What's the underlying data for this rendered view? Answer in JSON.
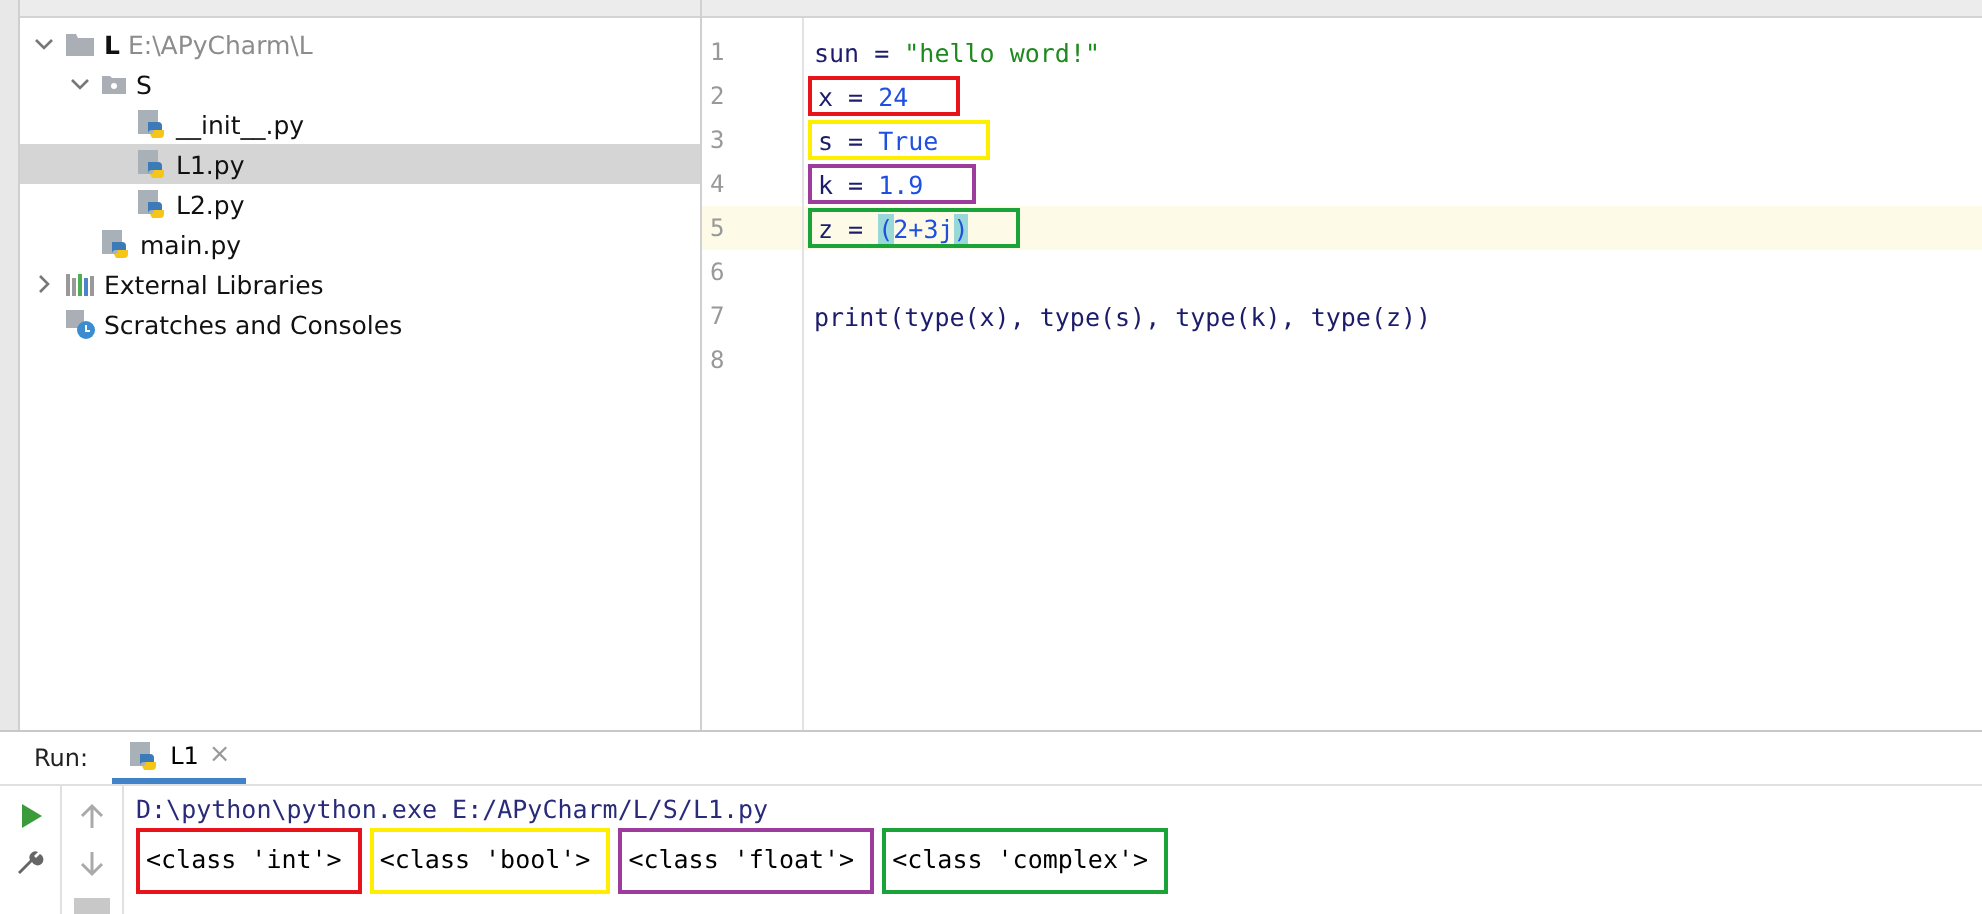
{
  "project_tree": [
    {
      "name": "L",
      "path": "E:\\APyCharm\\L",
      "kind": "root",
      "expanded": true,
      "selected": false,
      "children": [
        {
          "name": "S",
          "kind": "package",
          "expanded": true,
          "selected": false,
          "children": [
            {
              "name": "__init__.py",
              "kind": "python",
              "selected": false
            },
            {
              "name": "L1.py",
              "kind": "python",
              "selected": true
            },
            {
              "name": "L2.py",
              "kind": "python",
              "selected": false
            }
          ]
        },
        {
          "name": "main.py",
          "kind": "python",
          "selected": false
        }
      ]
    },
    {
      "name": "External Libraries",
      "kind": "libraries",
      "expanded": false,
      "selected": false
    },
    {
      "name": "Scratches and Consoles",
      "kind": "scratches",
      "selected": false
    }
  ],
  "editor": {
    "lines": [
      {
        "number": "1",
        "current": false,
        "tokens": [
          {
            "text": "sun = ",
            "kind": "plain"
          },
          {
            "text": "\"hello word!\"",
            "kind": "string"
          }
        ]
      },
      {
        "number": "2",
        "current": false,
        "color": "#e8141c",
        "tokens": [
          {
            "text": "x = ",
            "kind": "plain"
          },
          {
            "text": "24",
            "kind": "number"
          }
        ]
      },
      {
        "number": "3",
        "current": false,
        "color": "#ffee00",
        "tokens": [
          {
            "text": "s = ",
            "kind": "plain"
          },
          {
            "text": "True",
            "kind": "number"
          }
        ]
      },
      {
        "number": "4",
        "current": false,
        "color": "#9c3d9e",
        "tokens": [
          {
            "text": "k = ",
            "kind": "plain"
          },
          {
            "text": "1.9",
            "kind": "number"
          }
        ]
      },
      {
        "number": "5",
        "current": true,
        "color": "#1aa338",
        "tokens": [
          {
            "text": "z = ",
            "kind": "plain"
          },
          {
            "text": "(",
            "kind": "brace"
          },
          {
            "text": "2+3j",
            "kind": "number"
          },
          {
            "text": ")",
            "kind": "brace"
          }
        ]
      },
      {
        "number": "6",
        "current": false
      },
      {
        "number": "7",
        "current": false,
        "tokens": [
          {
            "text": "print(type(x), type(s), type(k), type(z))",
            "kind": "plain"
          }
        ]
      },
      {
        "number": "8",
        "current": false
      }
    ]
  },
  "run_panel": {
    "label": "Run:",
    "tabs": [
      {
        "label": "L1",
        "selected": true,
        "close": "×"
      }
    ],
    "command": "D:\\python\\python.exe E:/APyCharm/L/S/L1.py",
    "outputs": [
      {
        "text": "<class 'int'>",
        "color": "#e8141c"
      },
      {
        "text": "<class 'bool'>",
        "color": "#ffee00"
      },
      {
        "text": "<class 'float'>",
        "color": "#9c3d9e"
      },
      {
        "text": "<class 'complex'>",
        "color": "#1aa338"
      }
    ]
  }
}
